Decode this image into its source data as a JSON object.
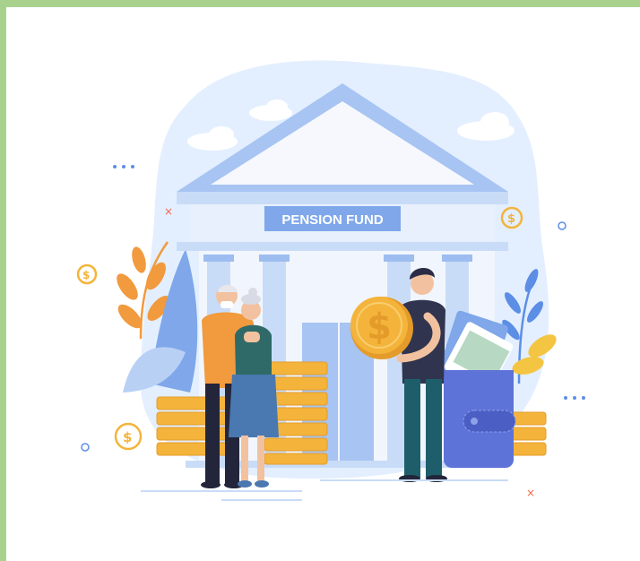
{
  "illustration": {
    "sign_text": "PENSION FUND",
    "coin_symbol": "$",
    "colors": {
      "border": "#a9d18e",
      "background": "#ffffff",
      "sky": "#e3efff",
      "building": "#c9dcf7",
      "building_dark": "#9dbdf0",
      "sign": "#7fa7ea",
      "gold": "#f4b43b",
      "gold_dark": "#e49b2a",
      "wallet": "#5d73d8",
      "shirt_dark": "#30344f",
      "pants": "#1e5e6b",
      "orange_shirt": "#f19a3e",
      "dress": "#4a78b0"
    }
  }
}
